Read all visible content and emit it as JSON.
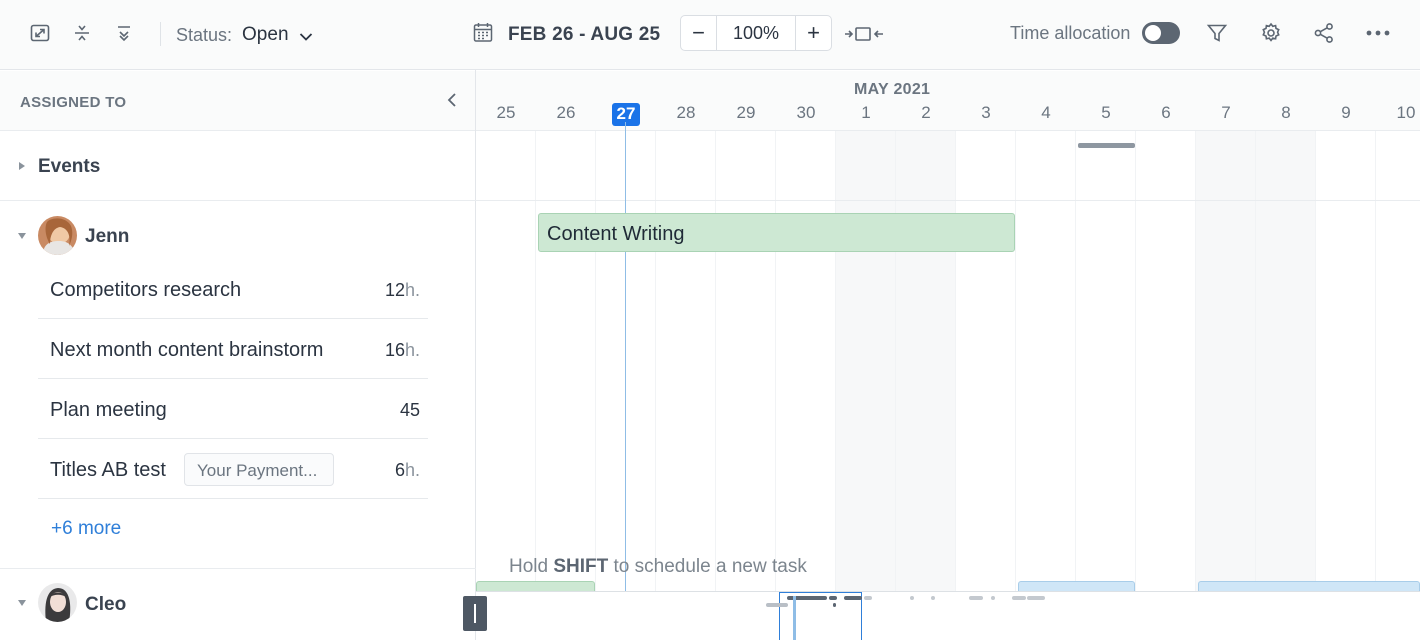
{
  "toolbar": {
    "icons": [
      "expand-icon",
      "collapse-rows-icon",
      "collapse-all-icon"
    ],
    "status_label": "Status:",
    "status_value": "Open",
    "date_range": "FEB 26 - AUG 25",
    "zoom_minus": "−",
    "zoom_value": "100%",
    "zoom_plus": "+",
    "time_allocation_label": "Time allocation",
    "time_allocation_enabled": false,
    "right_icons": [
      "filter-icon",
      "settings-icon",
      "share-icon",
      "more-icon"
    ]
  },
  "left_panel": {
    "header": "ASSIGNED TO",
    "groups": {
      "events": "Events",
      "jenn": "Jenn",
      "cleo": "Cleo"
    },
    "jenn_tasks": [
      {
        "name": "Competitors research",
        "hours_num": "12",
        "hours_unit": "h."
      },
      {
        "name": "Next month content brainstorm",
        "hours_num": "16",
        "hours_unit": "h."
      },
      {
        "name": "Plan meeting",
        "hours_num": "45",
        "hours_unit": ""
      },
      {
        "name": "Titles AB test",
        "tag": "Your Payment...",
        "hours_num": "6",
        "hours_unit": "h."
      }
    ],
    "more": "+6 more"
  },
  "timeline": {
    "month": "MAY 2021",
    "days": [
      "25",
      "26",
      "27",
      "28",
      "29",
      "30",
      "1",
      "2",
      "3",
      "4",
      "5",
      "6",
      "7",
      "8",
      "9",
      "10"
    ],
    "today_day": "27",
    "bar_label": "Content Writing",
    "hint_prefix": "Hold ",
    "hint_key": "SHIFT",
    "hint_suffix": " to schedule a new task"
  },
  "colors": {
    "accent": "#1a73e8",
    "task_green": "#cde8d3",
    "task_blue": "#cfe6f7",
    "link": "#2f7fd9"
  }
}
